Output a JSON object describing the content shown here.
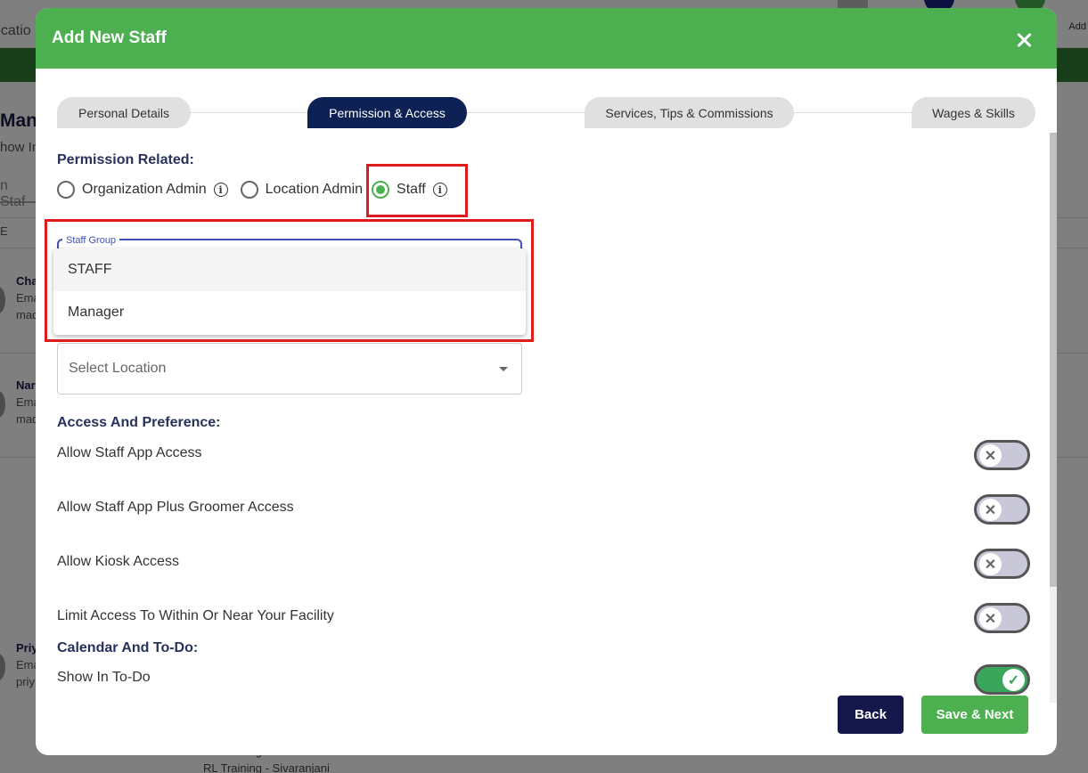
{
  "background": {
    "location_text": "ocatio",
    "add_text": "Add",
    "title": "Man",
    "subtitle": "how In",
    "search": "n Staf",
    "col": "E",
    "rows": [
      {
        "name": "Cha",
        "line1": "Ema",
        "line2": "mad"
      },
      {
        "name": "Nar",
        "line1": "Ema",
        "line2": "mad"
      },
      {
        "name": "Priy",
        "line1": "Ema",
        "line2": "priy"
      }
    ],
    "bottom_lines": [
      "RL Training - Vishanth",
      "RL Training - Sivaranjani"
    ]
  },
  "modal": {
    "title": "Add New Staff",
    "steps": [
      {
        "label": "Personal Details"
      },
      {
        "label": "Permission & Access"
      },
      {
        "label": "Services, Tips & Commissions"
      },
      {
        "label": "Wages & Skills"
      }
    ],
    "permission": {
      "heading": "Permission Related:",
      "options": [
        "Organization Admin",
        "Location Admin",
        "Staff"
      ],
      "selected": "Staff"
    },
    "staff_group": {
      "label": "Staff Group",
      "options": [
        "STAFF",
        "Manager"
      ]
    },
    "location_select": {
      "placeholder": "Select Location"
    },
    "access_heading": "Access And Preference:",
    "access_items": [
      {
        "label": "Allow Staff App Access",
        "enabled": false
      },
      {
        "label": "Allow Staff App Plus Groomer Access",
        "enabled": false
      },
      {
        "label": "Allow Kiosk Access",
        "enabled": false
      },
      {
        "label": "Limit Access To Within Or Near Your Facility",
        "enabled": false
      }
    ],
    "calendar_heading": "Calendar And To-Do:",
    "calendar_items": [
      {
        "label": "Show In To-Do",
        "enabled": true
      }
    ],
    "buttons": {
      "back": "Back",
      "save_next": "Save & Next"
    }
  },
  "colors": {
    "header_green": "#4caf50",
    "active_step": "#0d2155",
    "highlight_red": "#e01b1b"
  }
}
